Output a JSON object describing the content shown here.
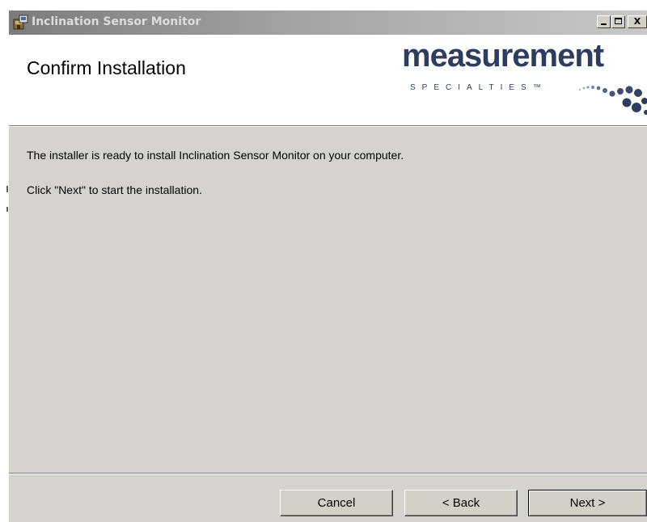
{
  "window": {
    "title": "Inclination Sensor Monitor",
    "icon": "installer-icon",
    "controls": {
      "minimize_icon": "minimize-icon",
      "maximize_icon": "maximize-icon",
      "close_label": "X"
    }
  },
  "banner": {
    "title": "Confirm Installation",
    "logo_word": "measurement",
    "logo_sub": "SPECIALTIES™",
    "logo_color": "#2e3c5f",
    "logo_dots_color": "#2e3c5f"
  },
  "body": {
    "line1": "The installer is ready to install Inclination Sensor Monitor on your computer.",
    "line2": "Click \"Next\" to start the installation."
  },
  "buttons": {
    "cancel": "Cancel",
    "back": "< Back",
    "next": "Next >"
  },
  "colors": {
    "dialog_bg": "#d6d3ce",
    "banner_bg": "#ffffff",
    "titlebar_inactive": "#a3a3a3"
  }
}
